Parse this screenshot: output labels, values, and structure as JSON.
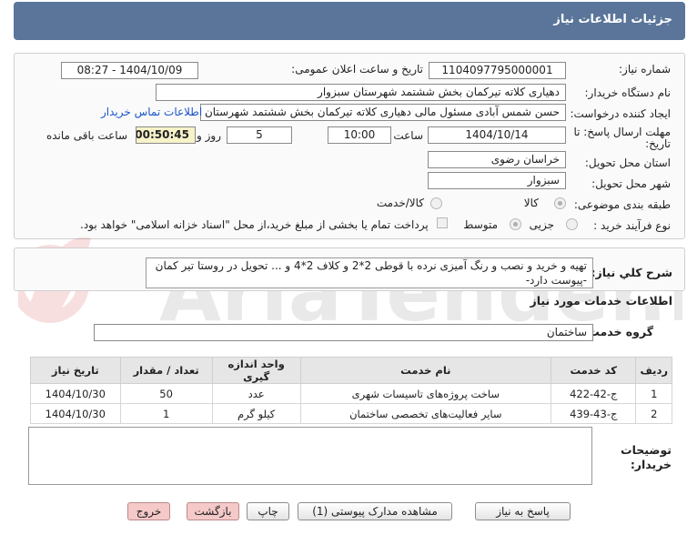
{
  "header": {
    "title": "جزئیات اطلاعات نیاز"
  },
  "fields": {
    "need_number_label": "شماره نیاز:",
    "need_number": "1104097795000001",
    "announce_label": "تاریخ و ساعت اعلان عمومی:",
    "announce_value": "1404/10/09 - 08:27",
    "buyer_org_label": "نام دستگاه خریدار:",
    "buyer_org": "دهیاری کلاته تیرکمان بخش ششتمد شهرستان سبزوار",
    "creator_label": "ایجاد کننده درخواست:",
    "creator": "حسن شمس آبادی مسئول مالی دهیاری کلاته تیرکمان بخش ششتمد شهرستان سبزوار",
    "contact_link": "اطلاعات تماس خریدار",
    "deadline_label_1": "مهلت ارسال پاسخ: تا",
    "deadline_label_2": "تاریخ:",
    "deadline_date": "1404/10/14",
    "time_label": "ساعت",
    "deadline_time": "10:00",
    "days_value": "5",
    "days_label": "روز و",
    "remaining_time": "00:50:45",
    "remaining_label": "ساعت باقی مانده",
    "province_label": "استان محل تحویل:",
    "province": "خراسان رضوی",
    "city_label": "شهر محل تحویل:",
    "city": "سبزوار",
    "category_label": "طبقه بندی موضوعی:",
    "category_options": [
      "کالا",
      "کالا/خدمت"
    ],
    "purchase_type_label": "نوع فرآیند خرید :",
    "purchase_options": [
      "جزیی",
      "متوسط"
    ],
    "payment_note": "پرداخت تمام یا بخشی از مبلغ خرید،از محل \"اسناد خزانه اسلامی\" خواهد بود."
  },
  "summary": {
    "label": "شرح کلي نياز:",
    "text": "تهیه و خرید و نصب و رنگ آمیزی نرده با قوطی 2*2 و کلاف 2*4 و ... تحویل در روستا تیر کمان -پیوست دارد-"
  },
  "services": {
    "section_title": "اطلاعات خدمات مورد نیاز",
    "group_label": "گروه خدمت:",
    "group_value": "ساختمان",
    "columns": [
      "ردیف",
      "کد خدمت",
      "نام خدمت",
      "واحد اندازه گیری",
      "تعداد / مقدار",
      "تاریخ نیاز"
    ],
    "rows": [
      [
        "1",
        "ج-42-422",
        "ساخت پروژه‌های تاسیسات شهری",
        "عدد",
        "50",
        "1404/10/30"
      ],
      [
        "2",
        "ج-43-439",
        "سایر فعالیت‌های تخصصی ساختمان",
        "کیلو گرم",
        "1",
        "1404/10/30"
      ]
    ]
  },
  "buyer_notes": {
    "label_1": "توضیحات",
    "label_2": "خریدار:"
  },
  "buttons": {
    "reply": "پاسخ به نیاز",
    "attachments": "مشاهده مدارک پیوستی (1)",
    "print": "چاپ",
    "back": "بازگشت",
    "exit": "خروج"
  },
  "watermark": {
    "text": "AriaTender.net"
  }
}
